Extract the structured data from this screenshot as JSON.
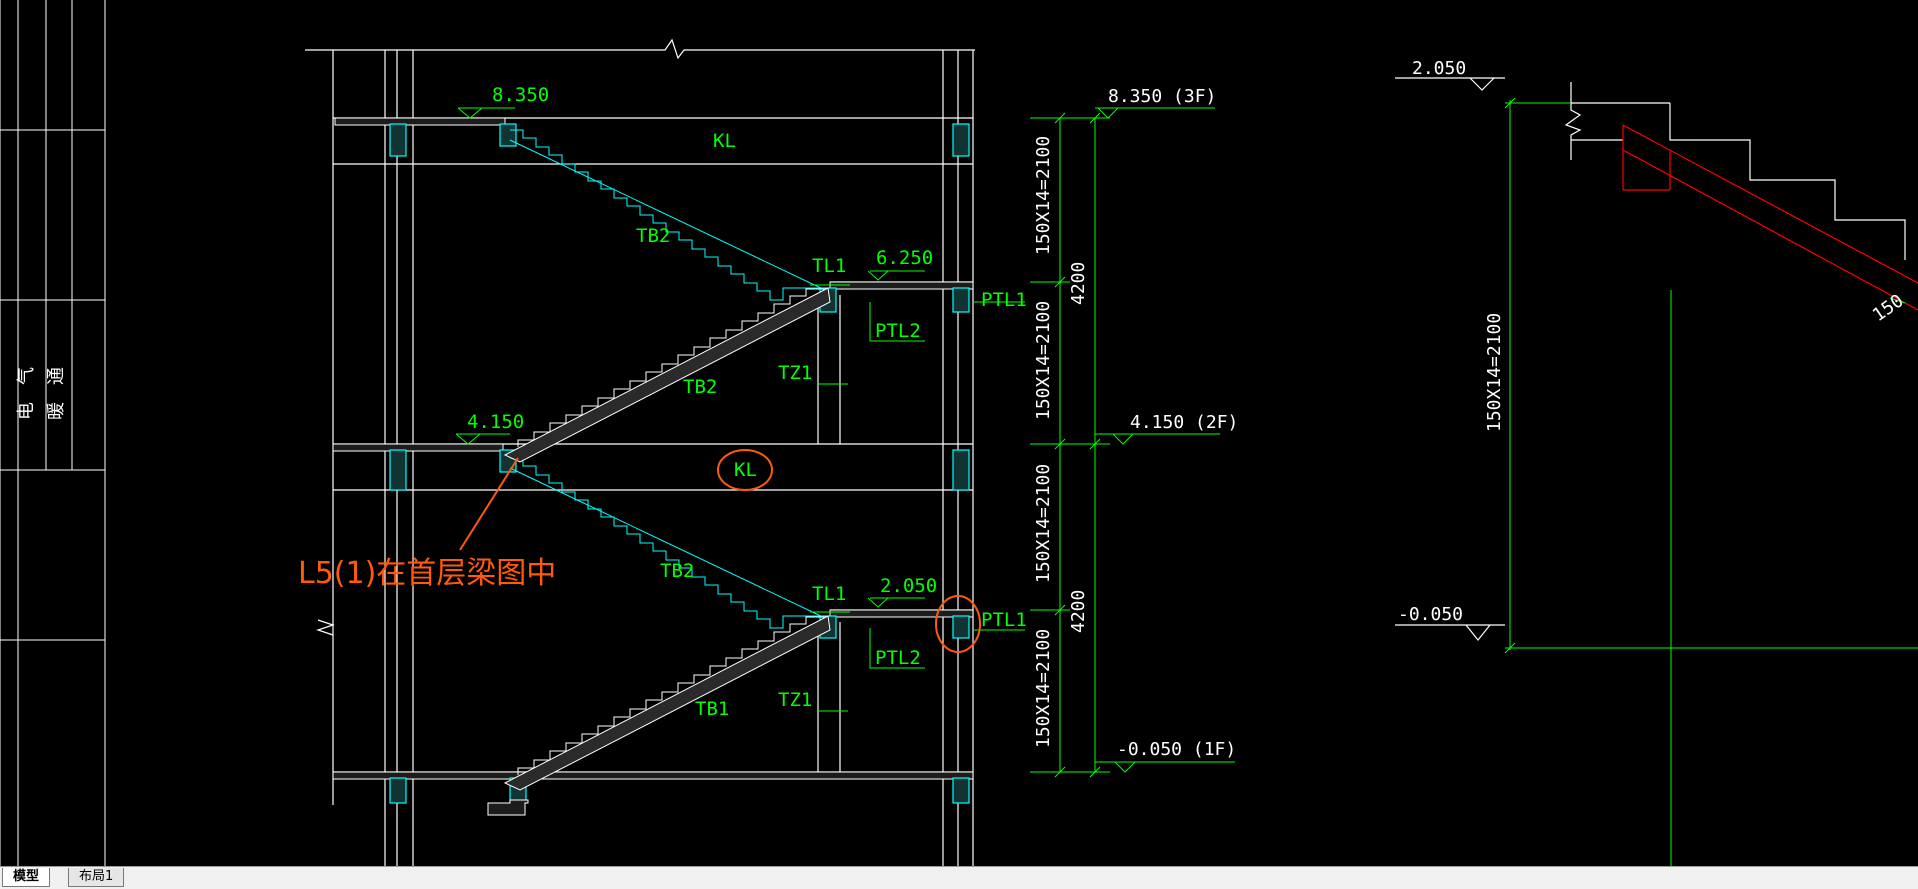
{
  "colors": {
    "background": "#000000",
    "white_line": "#ffffff",
    "green_text": "#00ff00",
    "cyan_line": "#00ffff",
    "red_line": "#ff0000",
    "annotation": "#ff5a0a"
  },
  "side_panel": {
    "labels": [
      "电",
      "气",
      "暖",
      "通"
    ]
  },
  "section": {
    "elev_top": "8.350",
    "elev_mid_landing": "6.250",
    "elev_2f": "4.150",
    "elev_low_landing": "2.050",
    "kl_top": "KL",
    "kl_circled": "KL",
    "tb2_upper_a": "TB2",
    "tb2_upper_b": "TB2",
    "tb2_lower": "TB2",
    "tb1": "TB1",
    "tl1_upper": "TL1",
    "tl1_lower": "TL1",
    "ptl1_upper": "PTL1",
    "ptl1_lower": "PTL1",
    "ptl2_upper": "PTL2",
    "ptl2_lower": "PTL2",
    "tz1_upper": "TZ1",
    "tz1_lower": "TZ1",
    "note": "L5(1)在首层梁图中"
  },
  "dimensions": {
    "level_3f": "8.350 (3F)",
    "level_2f": "4.150 (2F)",
    "level_1f": "-0.050 (1F)",
    "flight_1": "150X14=2100",
    "flight_2": "150X14=2100",
    "flight_3": "150X14=2100",
    "flight_4": "150X14=2100",
    "storey_upper": "4200",
    "storey_lower": "4200"
  },
  "detail": {
    "elev_top": "2.050",
    "elev_bottom": "-0.050",
    "flight": "150X14=2100",
    "thickness": "150"
  },
  "tabs": {
    "model": "模型",
    "layout1": "布局1"
  }
}
